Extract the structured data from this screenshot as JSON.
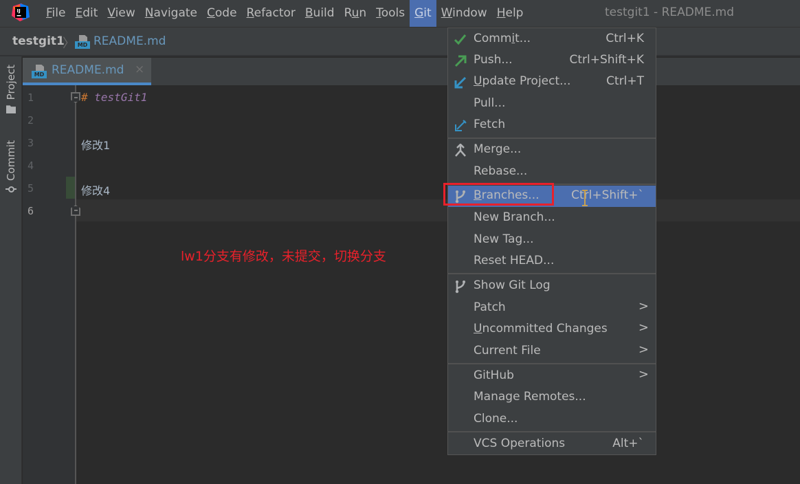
{
  "app": {
    "logo_text": "IJ",
    "window_title": "testgit1 - README.md"
  },
  "menubar": {
    "items": [
      {
        "label": "File",
        "mnemonic": "F",
        "rest": "ile"
      },
      {
        "label": "Edit",
        "mnemonic": "E",
        "rest": "dit"
      },
      {
        "label": "View",
        "mnemonic": "V",
        "rest": "iew"
      },
      {
        "label": "Navigate",
        "mnemonic": "N",
        "rest": "avigate"
      },
      {
        "label": "Code",
        "mnemonic": "C",
        "rest": "ode"
      },
      {
        "label": "Refactor",
        "mnemonic": "R",
        "rest": "efactor"
      },
      {
        "label": "Build",
        "mnemonic": "B",
        "rest": "uild"
      },
      {
        "label": "Run",
        "pre": "R",
        "mnemonic": "u",
        "rest": "n"
      },
      {
        "label": "Tools",
        "mnemonic": "T",
        "rest": "ools"
      },
      {
        "label": "Git",
        "mnemonic": "G",
        "rest": "it",
        "active": true
      },
      {
        "label": "Window",
        "mnemonic": "W",
        "rest": "indow"
      },
      {
        "label": "Help",
        "mnemonic": "H",
        "rest": "elp"
      }
    ]
  },
  "breadcrumb": {
    "project": "testgit1",
    "separator": "〉",
    "file": "README.md",
    "file_icon": "markdown-file-icon",
    "md_badge": "MD"
  },
  "tool_strip": {
    "project_label": "Project",
    "commit_label": "Commit"
  },
  "editor_tab": {
    "label": "README.md",
    "close": "×"
  },
  "editor": {
    "line_numbers": [
      "1",
      "2",
      "3",
      "4",
      "5",
      "6"
    ],
    "current_line": "6",
    "lines": {
      "l1_hash": "#",
      "l1_heading": "testGit1",
      "l3": "修改1",
      "l5": "修改4"
    },
    "changed_line": "5"
  },
  "annotation": "lw1分支有修改，未提交，切换分支",
  "git_menu": {
    "commit": {
      "pre": "Comm",
      "mn": "i",
      "post": "t...",
      "shortcut": "Ctrl+K",
      "icon": "checkmark-icon"
    },
    "push": {
      "label": "Push...",
      "shortcut": "Ctrl+Shift+K",
      "icon": "push-arrow-icon"
    },
    "update": {
      "mn": "U",
      "post": "pdate Project...",
      "shortcut": "Ctrl+T",
      "icon": "update-arrow-icon"
    },
    "pull": {
      "label": "Pull..."
    },
    "fetch": {
      "label": "Fetch",
      "icon": "fetch-icon"
    },
    "merge": {
      "label": "Merge...",
      "icon": "merge-icon"
    },
    "rebase": {
      "label": "Rebase..."
    },
    "branches": {
      "mn": "B",
      "post": "ranches...",
      "shortcut": "Ctrl+Shift+`",
      "icon": "branch-icon"
    },
    "new_branch": {
      "label": "New Branch..."
    },
    "new_tag": {
      "label": "New Tag..."
    },
    "reset_head": {
      "label": "Reset HEAD..."
    },
    "show_git_log": {
      "label": "Show Git Log",
      "icon": "branch-icon"
    },
    "patch": {
      "label": "Patch",
      "arrow": ">"
    },
    "uncommitted": {
      "mn": "U",
      "post": "ncommitted Changes",
      "arrow": ">"
    },
    "current_file": {
      "label": "Current File",
      "arrow": ">"
    },
    "github": {
      "label": "GitHub",
      "arrow": ">"
    },
    "manage_remotes": {
      "label": "Manage Remotes..."
    },
    "clone": {
      "label": "Clone..."
    },
    "vcs_operations": {
      "label": "VCS Operations",
      "shortcut": "Alt+`"
    }
  },
  "colors": {
    "accent": "#4b6eaf",
    "annotation_red": "#e8212b",
    "tab_underline": "#4a88c7"
  }
}
